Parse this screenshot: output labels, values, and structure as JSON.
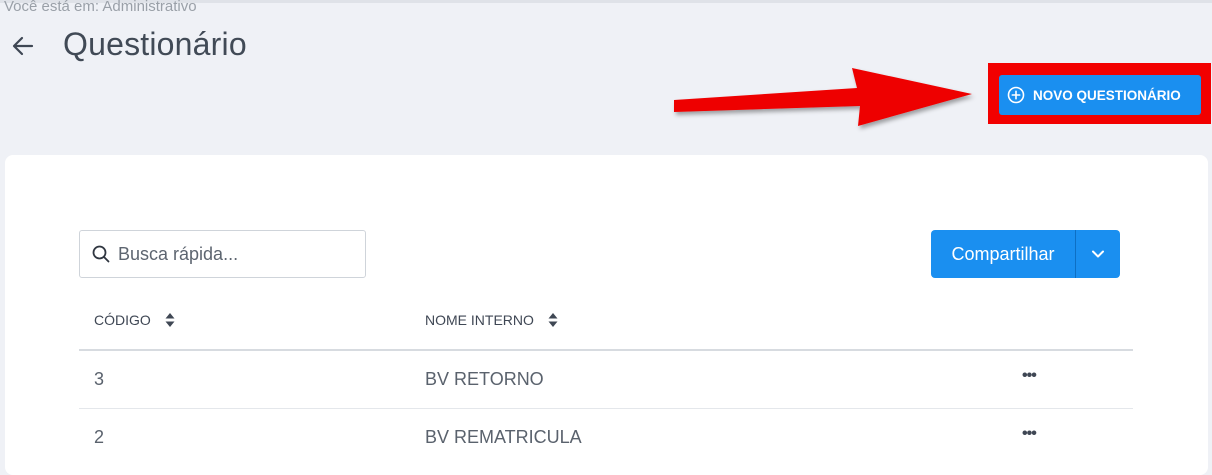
{
  "breadcrumb": "Você está em: Administrativo",
  "page": {
    "title": "Questionário"
  },
  "header": {
    "new_button_label": "NOVO QUESTIONÁRIO"
  },
  "search": {
    "placeholder": "Busca rápida..."
  },
  "share": {
    "label": "Compartilhar"
  },
  "table": {
    "columns": [
      "CÓDIGO",
      "NOME INTERNO"
    ],
    "rows": [
      {
        "code": "3",
        "name": "BV RETORNO",
        "menu": "•••"
      },
      {
        "code": "2",
        "name": "BV REMATRICULA",
        "menu": "•••"
      }
    ]
  },
  "colors": {
    "primary": "#1a8ff0",
    "background": "#eff1f6",
    "highlight": "#f20000"
  },
  "icons": [
    "arrow-left-icon",
    "plus-circle-icon",
    "search-icon",
    "chevron-down-icon",
    "sort-icon",
    "more-horizontal-icon",
    "red-arrow-annotation"
  ]
}
